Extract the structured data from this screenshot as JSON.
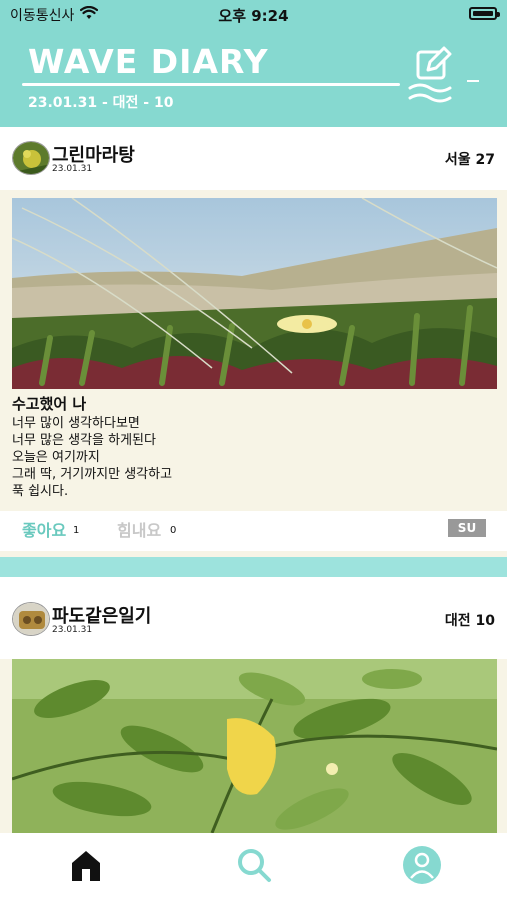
{
  "status": {
    "carrier": "이동통신사",
    "time": "오후 9:24"
  },
  "header": {
    "brand": "WAVE DIARY",
    "subtitle": "23.01.31 - 대전 - 10"
  },
  "posts": [
    {
      "author": "그린마라탕",
      "date": "23.01.31",
      "location": "서울 27",
      "title": "수고했어 나",
      "body": "너무 많이 생각하다보면\n너무 많은 생각을 하게된다\n오늘은 여기까지\n그래 딱, 거기까지만 생각하고\n푹 쉽시다.",
      "like_label": "좋아요",
      "like_count": "1",
      "cheer_label": "힘내요",
      "cheer_count": "0",
      "tag": "SU"
    },
    {
      "author": "파도같은일기",
      "date": "23.01.31",
      "location": "대전 10"
    }
  ],
  "icons": {
    "compose": "compose-wave-icon",
    "home": "home-icon",
    "search": "search-icon",
    "profile": "profile-icon"
  },
  "colors": {
    "header": "#86d9d0",
    "accent": "#6ac9be",
    "divider": "#9de3dd",
    "card": "#f7f4e6"
  }
}
